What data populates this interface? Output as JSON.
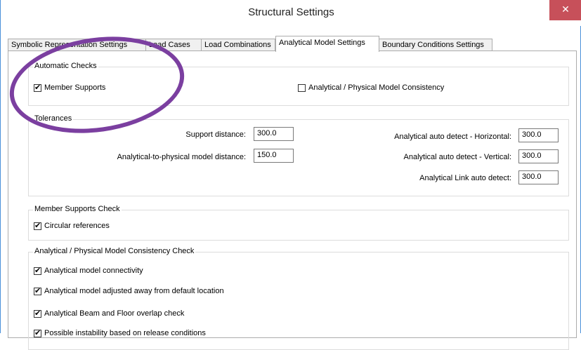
{
  "window": {
    "title": "Structural Settings",
    "close_glyph": "✕"
  },
  "tabs": [
    {
      "label": "Symbolic Representation Settings"
    },
    {
      "label": "Load Cases"
    },
    {
      "label": "Load Combinations"
    },
    {
      "label": "Analytical Model Settings"
    },
    {
      "label": "Boundary Conditions Settings"
    }
  ],
  "automatic_checks": {
    "title": "Automatic Checks",
    "member_supports": {
      "label": "Member Supports",
      "checked": true
    },
    "consistency": {
      "label": "Analytical / Physical Model Consistency",
      "checked": false
    }
  },
  "tolerances": {
    "title": "Tolerances",
    "support_distance": {
      "label": "Support distance:",
      "value": "300.0"
    },
    "analytical_to_physical": {
      "label": "Analytical-to-physical model distance:",
      "value": "150.0"
    },
    "auto_detect_horizontal": {
      "label": "Analytical auto detect - Horizontal:",
      "value": "300.0"
    },
    "auto_detect_vertical": {
      "label": "Analytical auto detect - Vertical:",
      "value": "300.0"
    },
    "link_auto_detect": {
      "label": "Analytical Link auto detect:",
      "value": "300.0"
    }
  },
  "member_supports_check": {
    "title": "Member Supports Check",
    "circular_references": {
      "label": "Circular references",
      "checked": true
    }
  },
  "consistency_check": {
    "title": "Analytical / Physical Model Consistency Check",
    "items": [
      {
        "label": "Analytical model connectivity",
        "checked": true
      },
      {
        "label": "Analytical model adjusted away from default location",
        "checked": true
      },
      {
        "label": "Analytical Beam and Floor overlap check",
        "checked": true
      },
      {
        "label": "Possible instability based on release conditions",
        "checked": true
      }
    ]
  },
  "colors": {
    "annotation_ring": "#7b3fa0",
    "close_button": "#c7505a"
  }
}
